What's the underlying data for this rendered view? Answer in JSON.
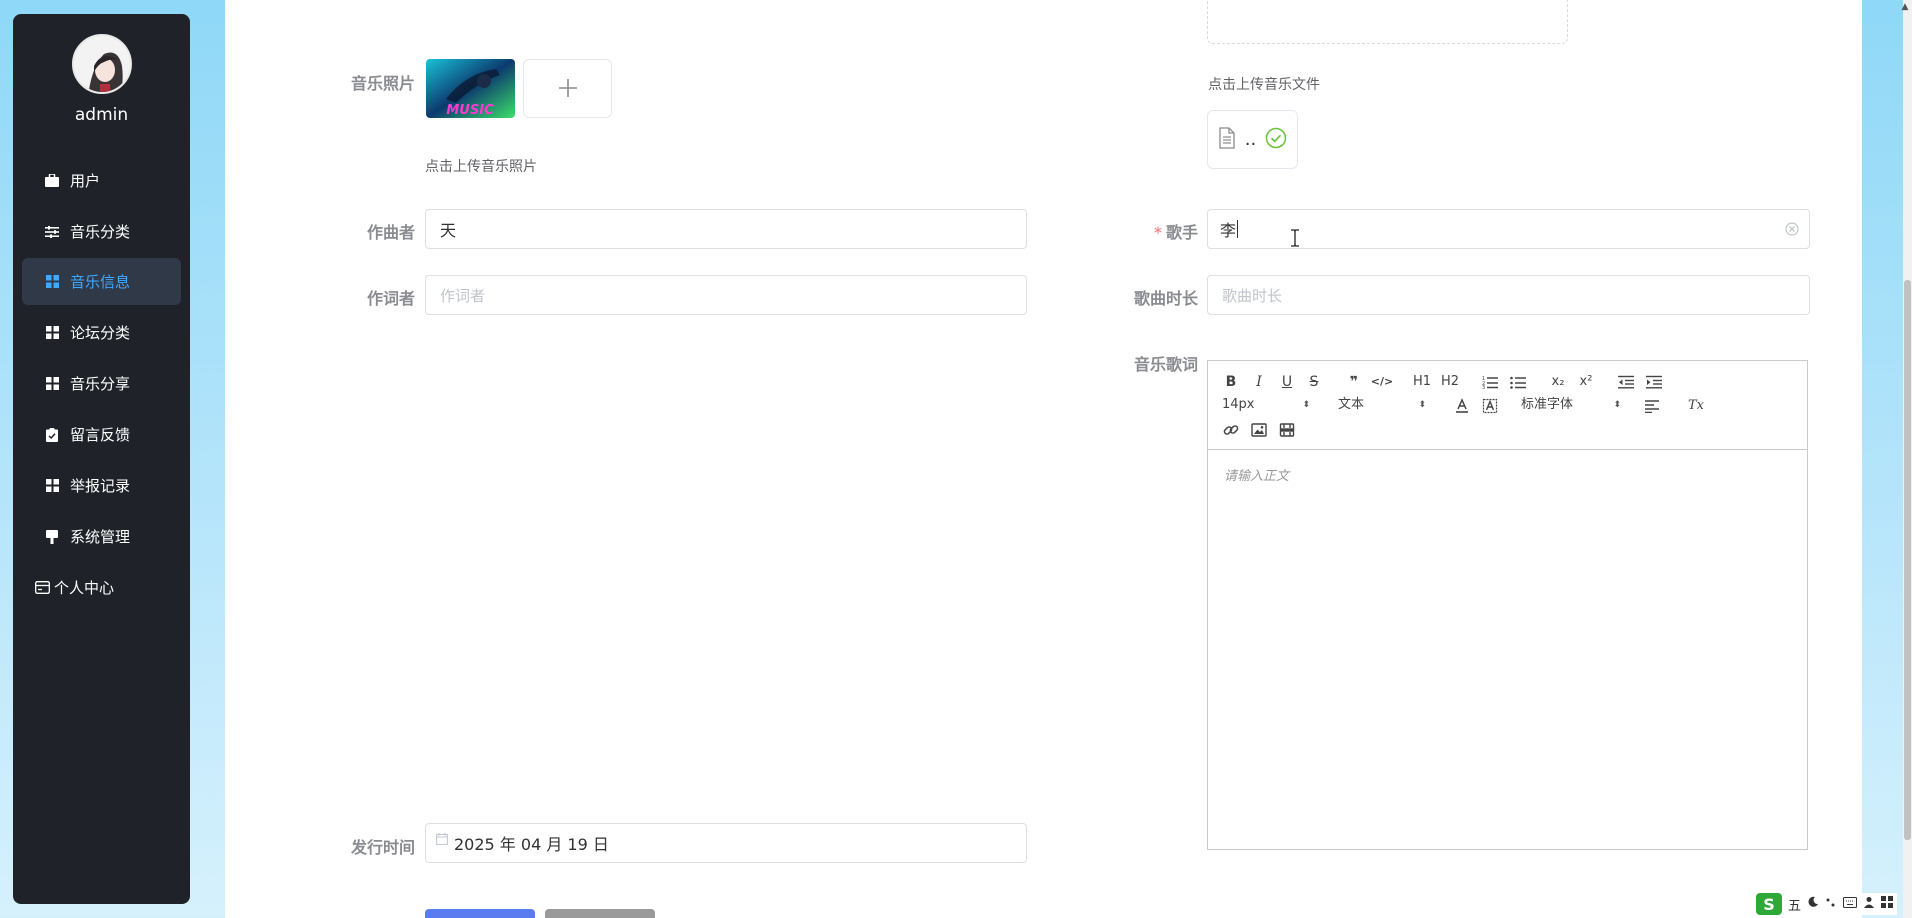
{
  "sidebar": {
    "username": "admin",
    "items": [
      {
        "label": "用户",
        "icon": "briefcase-icon"
      },
      {
        "label": "音乐分类",
        "icon": "sliders-icon"
      },
      {
        "label": "音乐信息",
        "icon": "grid-icon"
      },
      {
        "label": "论坛分类",
        "icon": "grid-icon"
      },
      {
        "label": "音乐分享",
        "icon": "grid-icon"
      },
      {
        "label": "留言反馈",
        "icon": "clipboard-icon"
      },
      {
        "label": "举报记录",
        "icon": "grid-icon"
      },
      {
        "label": "系统管理",
        "icon": "brush-icon"
      },
      {
        "label": "个人中心",
        "icon": "card-icon"
      }
    ],
    "active_index": 2,
    "active_color": "#40a9ff"
  },
  "form": {
    "photo": {
      "label": "音乐照片",
      "thumb_text": "MUSIC",
      "hint": "点击上传音乐照片"
    },
    "file": {
      "hint": "点击上传音乐文件",
      "file_name": ".."
    },
    "composer": {
      "label": "作曲者",
      "value": "天"
    },
    "lyricist": {
      "label": "作词者",
      "placeholder": "作词者",
      "value": ""
    },
    "singer": {
      "label": "歌手",
      "required_mark": "*",
      "value": "李"
    },
    "duration": {
      "label": "歌曲时长",
      "placeholder": "歌曲时长",
      "value": ""
    },
    "lyrics": {
      "label": "音乐歌词",
      "placeholder": "请输入正文"
    },
    "release": {
      "label": "发行时间",
      "value": "2025 年 04 月 19 日"
    }
  },
  "editor_toolbar": {
    "bold": "B",
    "italic": "I",
    "underline": "U",
    "strike": "S",
    "quote": "❞",
    "code": "</>",
    "h1": "H1",
    "h2": "H2",
    "subscript": "x₂",
    "superscript": "x²",
    "size": "14px",
    "header": "文本",
    "font": "标准字体",
    "clean": "Tx"
  },
  "ime": {
    "logo": "S",
    "mode": "五"
  },
  "colors": {
    "sidebar_bg": "#1f2329",
    "primary_button": "#5a7cf0",
    "required": "#f56c6c",
    "success": "#67c23a"
  }
}
